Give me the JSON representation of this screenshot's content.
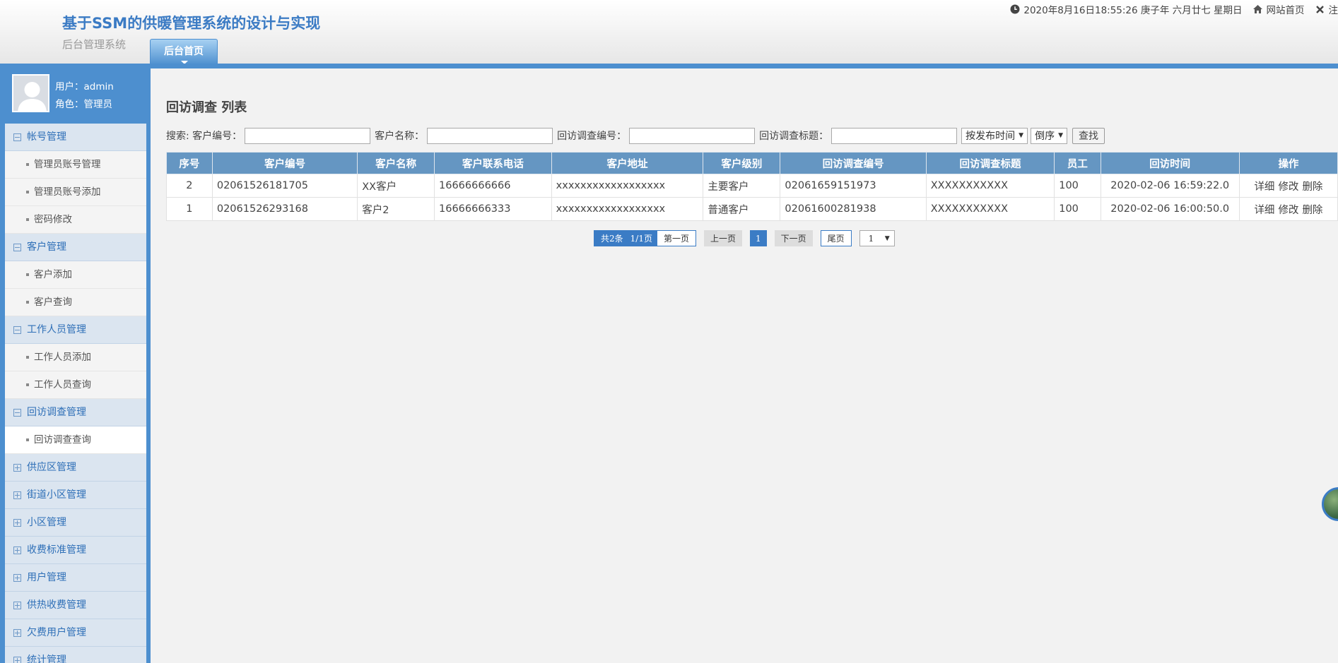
{
  "header": {
    "system_title": "基于SSM的供暖管理系统的设计与实现",
    "system_subtitle": "后台管理系统",
    "home_tab": "后台首页",
    "datetime": "2020年8月16日18:55:26 庚子年 六月廿七 星期日",
    "site_home": "网站首页",
    "logout": "注"
  },
  "user": {
    "user_label": "用户：admin",
    "role_label": "角色：管理员"
  },
  "sidebar": {
    "groups": [
      {
        "label": "帐号管理",
        "expanded": true,
        "items": [
          "管理员账号管理",
          "管理员账号添加",
          "密码修改"
        ]
      },
      {
        "label": "客户管理",
        "expanded": true,
        "items": [
          "客户添加",
          "客户查询"
        ]
      },
      {
        "label": "工作人员管理",
        "expanded": true,
        "items": [
          "工作人员添加",
          "工作人员查询"
        ]
      },
      {
        "label": "回访调查管理",
        "expanded": true,
        "items": [
          "回访调查查询"
        ]
      },
      {
        "label": "供应区管理",
        "expanded": false,
        "items": []
      },
      {
        "label": "街道小区管理",
        "expanded": false,
        "items": []
      },
      {
        "label": "小区管理",
        "expanded": false,
        "items": []
      },
      {
        "label": "收费标准管理",
        "expanded": false,
        "items": []
      },
      {
        "label": "用户管理",
        "expanded": false,
        "items": []
      },
      {
        "label": "供热收费管理",
        "expanded": false,
        "items": []
      },
      {
        "label": "欠费用户管理",
        "expanded": false,
        "items": []
      },
      {
        "label": "统计管理",
        "expanded": false,
        "items": []
      }
    ]
  },
  "main": {
    "title": "回访调查 列表",
    "search": {
      "prefix": "搜索: 客户编号：",
      "customer_name_label": "客户名称：",
      "survey_no_label": "回访调查编号：",
      "survey_title_label": "回访调查标题：",
      "sort_field": "按发布时间",
      "sort_order": "倒序",
      "find_button": "查找"
    },
    "table": {
      "headers": [
        "序号",
        "客户编号",
        "客户名称",
        "客户联系电话",
        "客户地址",
        "客户级别",
        "回访调查编号",
        "回访调查标题",
        "员工",
        "回访时间",
        "操作"
      ],
      "rows": [
        {
          "idx": "2",
          "customer_no": "02061526181705",
          "customer_name": "XX客户",
          "phone": "16666666666",
          "address": "xxxxxxxxxxxxxxxxxx",
          "level": "主要客户",
          "survey_no": "02061659151973",
          "survey_title": "XXXXXXXXXXX",
          "staff": "100",
          "time": "2020-02-06 16:59:22.0",
          "op_detail": "详细",
          "op_edit": "修改",
          "op_delete": "删除"
        },
        {
          "idx": "1",
          "customer_no": "02061526293168",
          "customer_name": "客户2",
          "phone": "16666666333",
          "address": "xxxxxxxxxxxxxxxxxx",
          "level": "普通客户",
          "survey_no": "02061600281938",
          "survey_title": "XXXXXXXXXXX",
          "staff": "100",
          "time": "2020-02-06 16:00:50.0",
          "op_detail": "详细",
          "op_edit": "修改",
          "op_delete": "删除"
        }
      ]
    },
    "pager": {
      "total": "共2条",
      "pages": "1/1页",
      "first": "第一页",
      "prev": "上一页",
      "current": "1",
      "next": "下一页",
      "last": "尾页",
      "jump": "1"
    }
  },
  "colors": {
    "accent": "#4d8fcf",
    "table_header": "#6596c2",
    "title_blue": "#3b7bc4"
  }
}
